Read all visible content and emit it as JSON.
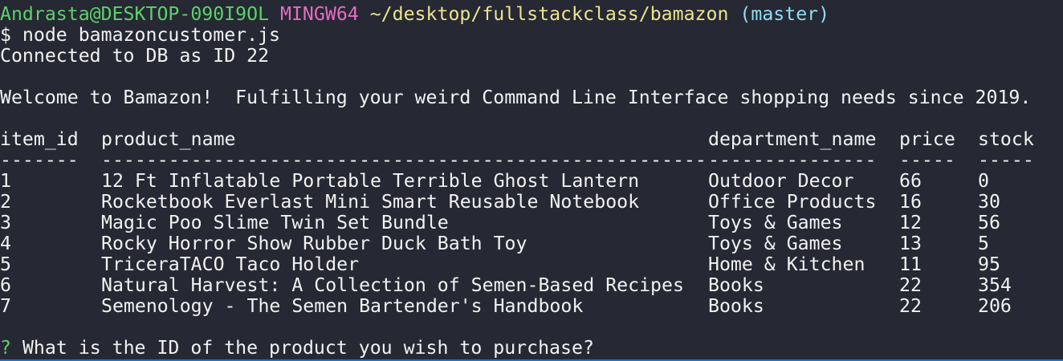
{
  "prompt": {
    "user_host": "Andrasta@DESKTOP-090I9OL",
    "system": "MINGW64",
    "path": "~/desktop/fullstackclass/bamazon",
    "branch": "(master)"
  },
  "command": "$ node bamazoncustomer.js",
  "connected": "Connected to DB as ID 22",
  "welcome": "Welcome to Bamazon!  Fulfilling your weird Command Line Interface shopping needs since 2019.",
  "table": {
    "headers": [
      "item_id",
      "product_name",
      "department_name",
      "price",
      "stock"
    ],
    "separators": [
      "-------",
      "------------------------------------------------------",
      "---------------",
      "-----",
      "-----"
    ],
    "rows": [
      [
        "1",
        "12 Ft Inflatable Portable Terrible Ghost Lantern",
        "Outdoor Decor",
        "66",
        "0"
      ],
      [
        "2",
        "Rocketbook Everlast Mini Smart Reusable Notebook",
        "Office Products",
        "16",
        "30"
      ],
      [
        "3",
        "Magic Poo Slime Twin Set Bundle",
        "Toys & Games",
        "12",
        "56"
      ],
      [
        "4",
        "Rocky Horror Show Rubber Duck Bath Toy",
        "Toys & Games",
        "13",
        "5"
      ],
      [
        "5",
        "TriceraTACO Taco Holder",
        "Home & Kitchen",
        "11",
        "95"
      ],
      [
        "6",
        "Natural Harvest: A Collection of Semen-Based Recipes",
        "Books",
        "22",
        "354"
      ],
      [
        "7",
        "Semenology - The Semen Bartender's Handbook",
        "Books",
        "22",
        "206"
      ]
    ]
  },
  "question": {
    "mark": "?",
    "text": "What is the ID of the product you wish to purchase?"
  },
  "colors": {
    "background": "#262833",
    "green": "#5cd26a",
    "pink": "#e36ec2",
    "yellow": "#ece58e",
    "cyan": "#8ddff2"
  }
}
